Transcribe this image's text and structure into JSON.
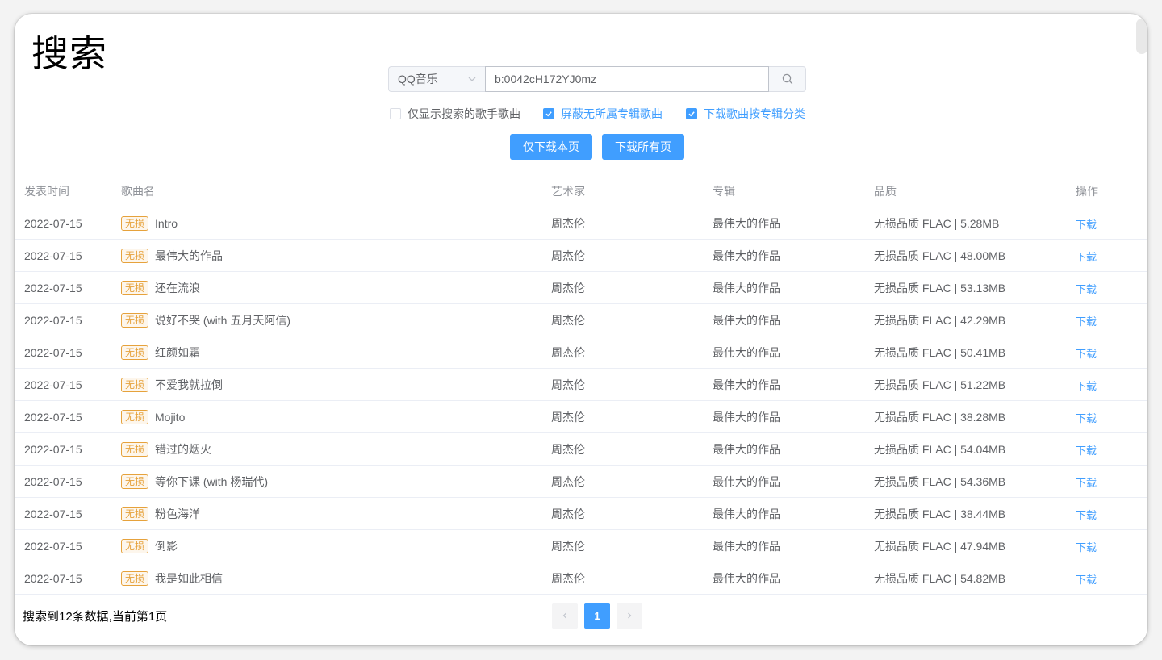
{
  "page": {
    "title": "搜索"
  },
  "search": {
    "source": "QQ音乐",
    "query": "b:0042cH172YJ0mz"
  },
  "options": [
    {
      "label": "仅显示搜索的歌手歌曲",
      "checked": false
    },
    {
      "label": "屏蔽无所属专辑歌曲",
      "checked": true
    },
    {
      "label": "下载歌曲按专辑分类",
      "checked": true
    }
  ],
  "actions": {
    "download_page": "仅下载本页",
    "download_all": "下载所有页"
  },
  "table": {
    "headers": {
      "date": "发表时间",
      "name": "歌曲名",
      "artist": "艺术家",
      "album": "专辑",
      "quality": "品质",
      "op": "操作"
    },
    "rows": [
      {
        "date": "2022-07-15",
        "tag": "无损",
        "name": "Intro",
        "artist": "周杰伦",
        "album": "最伟大的作品",
        "quality": "无损品质 FLAC | 5.28MB",
        "op": "下载"
      },
      {
        "date": "2022-07-15",
        "tag": "无损",
        "name": "最伟大的作品",
        "artist": "周杰伦",
        "album": "最伟大的作品",
        "quality": "无损品质 FLAC | 48.00MB",
        "op": "下载"
      },
      {
        "date": "2022-07-15",
        "tag": "无损",
        "name": "还在流浪",
        "artist": "周杰伦",
        "album": "最伟大的作品",
        "quality": "无损品质 FLAC | 53.13MB",
        "op": "下载"
      },
      {
        "date": "2022-07-15",
        "tag": "无损",
        "name": "说好不哭 (with 五月天阿信)",
        "artist": "周杰伦",
        "album": "最伟大的作品",
        "quality": "无损品质 FLAC | 42.29MB",
        "op": "下载"
      },
      {
        "date": "2022-07-15",
        "tag": "无损",
        "name": "红颜如霜",
        "artist": "周杰伦",
        "album": "最伟大的作品",
        "quality": "无损品质 FLAC | 50.41MB",
        "op": "下载"
      },
      {
        "date": "2022-07-15",
        "tag": "无损",
        "name": "不爱我就拉倒",
        "artist": "周杰伦",
        "album": "最伟大的作品",
        "quality": "无损品质 FLAC | 51.22MB",
        "op": "下载"
      },
      {
        "date": "2022-07-15",
        "tag": "无损",
        "name": "Mojito",
        "artist": "周杰伦",
        "album": "最伟大的作品",
        "quality": "无损品质 FLAC | 38.28MB",
        "op": "下载"
      },
      {
        "date": "2022-07-15",
        "tag": "无损",
        "name": "错过的烟火",
        "artist": "周杰伦",
        "album": "最伟大的作品",
        "quality": "无损品质 FLAC | 54.04MB",
        "op": "下载"
      },
      {
        "date": "2022-07-15",
        "tag": "无损",
        "name": "等你下课 (with 杨瑞代)",
        "artist": "周杰伦",
        "album": "最伟大的作品",
        "quality": "无损品质 FLAC | 54.36MB",
        "op": "下载"
      },
      {
        "date": "2022-07-15",
        "tag": "无损",
        "name": "粉色海洋",
        "artist": "周杰伦",
        "album": "最伟大的作品",
        "quality": "无损品质 FLAC | 38.44MB",
        "op": "下载"
      },
      {
        "date": "2022-07-15",
        "tag": "无损",
        "name": "倒影",
        "artist": "周杰伦",
        "album": "最伟大的作品",
        "quality": "无损品质 FLAC | 47.94MB",
        "op": "下载"
      },
      {
        "date": "2022-07-15",
        "tag": "无损",
        "name": "我是如此相信",
        "artist": "周杰伦",
        "album": "最伟大的作品",
        "quality": "无损品质 FLAC | 54.82MB",
        "op": "下载"
      }
    ]
  },
  "footer": {
    "summary": "搜索到12条数据,当前第1页",
    "current_page": "1"
  },
  "colors": {
    "accent": "#409eff",
    "tag": "#e6a23c"
  },
  "icons": {
    "select_arrow": "chevron-down-icon",
    "search": "search-icon",
    "prev": "chevron-left-icon",
    "next": "chevron-right-icon",
    "checkbox": "check-icon"
  }
}
